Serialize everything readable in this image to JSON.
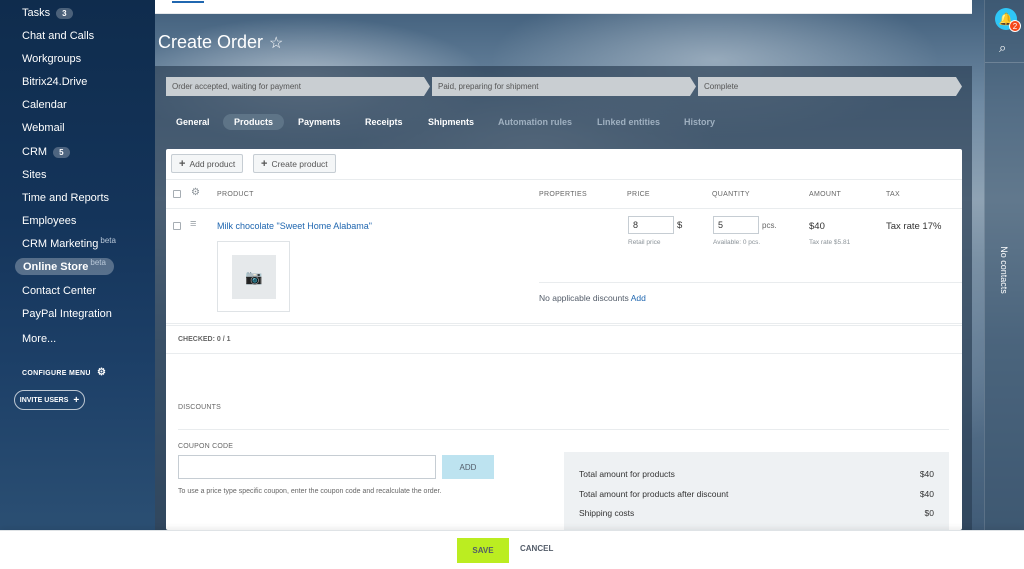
{
  "sidebar": {
    "items": [
      {
        "label": "Tasks",
        "badge": "3"
      },
      {
        "label": "Chat and Calls"
      },
      {
        "label": "Workgroups"
      },
      {
        "label": "Bitrix24.Drive"
      },
      {
        "label": "Calendar"
      },
      {
        "label": "Webmail"
      },
      {
        "label": "CRM",
        "badge": "5"
      },
      {
        "label": "Sites"
      },
      {
        "label": "Time and Reports"
      },
      {
        "label": "Employees"
      },
      {
        "label": "CRM Marketing",
        "beta": "beta"
      },
      {
        "label": "Online Store",
        "beta": "beta"
      },
      {
        "label": "Contact Center"
      },
      {
        "label": "PayPal Integration"
      },
      {
        "label": "More..."
      }
    ],
    "configure_menu": "CONFIGURE MENU",
    "invite_users": "INVITE USERS"
  },
  "rail": {
    "notifications_count": "2",
    "no_contacts": "No contacts"
  },
  "page": {
    "title": "Create Order",
    "star": "☆"
  },
  "stages": [
    "Order accepted, waiting for payment",
    "Paid, preparing for shipment",
    "Complete"
  ],
  "tabs": [
    {
      "label": "General",
      "state": "bold"
    },
    {
      "label": "Products",
      "state": "active"
    },
    {
      "label": "Payments",
      "state": "normal"
    },
    {
      "label": "Receipts",
      "state": "normal"
    },
    {
      "label": "Shipments",
      "state": "normal"
    },
    {
      "label": "Automation rules",
      "state": "muted"
    },
    {
      "label": "Linked entities",
      "state": "muted"
    },
    {
      "label": "History",
      "state": "muted"
    }
  ],
  "toolbar": {
    "add_product": "Add product",
    "create_product": "Create product"
  },
  "table": {
    "headers": {
      "product": "PRODUCT",
      "properties": "PROPERTIES",
      "price": "PRICE",
      "quantity": "QUANTITY",
      "amount": "AMOUNT",
      "tax": "TAX"
    },
    "row": {
      "name": "Milk chocolate \"Sweet Home Alabama\"",
      "price": "8",
      "currency": "$",
      "price_type": "Retail price",
      "quantity": "5",
      "unit": "pcs.",
      "available": "Available: 0 pcs.",
      "amount": "$40",
      "tax_rate_sub": "Tax rate $5.81",
      "tax": "Tax rate 17%"
    },
    "no_discounts": "No applicable discounts",
    "add_discount": "Add",
    "checked": "CHECKED: 0 / 1"
  },
  "discounts": {
    "heading": "DISCOUNTS",
    "coupon_label": "COUPON CODE",
    "coupon_value": "",
    "add_button": "ADD",
    "hint": "To use a price type specific coupon, enter the coupon code and recalculate the order."
  },
  "totals": [
    {
      "label": "Total amount for products",
      "value": "$40"
    },
    {
      "label": "Total amount for products after discount",
      "value": "$40"
    },
    {
      "label": "Shipping costs",
      "value": "$0"
    }
  ],
  "footer": {
    "save": "SAVE",
    "cancel": "CANCEL"
  }
}
